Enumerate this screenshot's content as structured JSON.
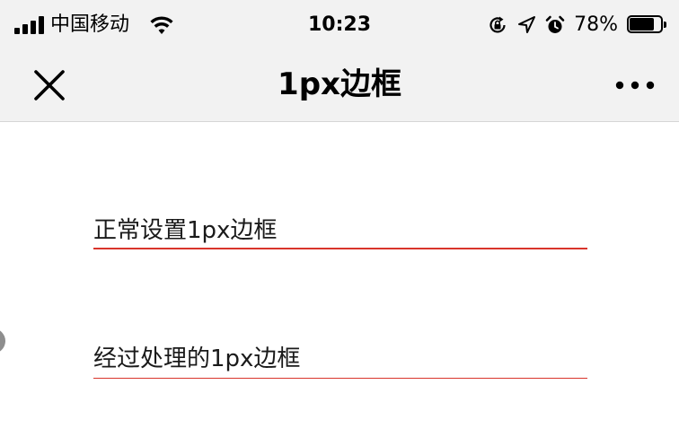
{
  "status_bar": {
    "carrier": "中国移动",
    "time": "10:23",
    "battery_percent_text": "78%",
    "battery_level": 0.78,
    "icons": [
      "signal-icon",
      "wifi-icon",
      "rotation-lock-icon",
      "location-arrow-icon",
      "alarm-icon",
      "battery-icon"
    ]
  },
  "nav": {
    "title": "1px边框",
    "close_icon": "close-icon",
    "more_icon": "more-icon"
  },
  "content": {
    "items": [
      {
        "label": "正常设置1px边框",
        "border_color": "#d9342b"
      },
      {
        "label": "经过处理的1px边框",
        "border_color": "#d9342b"
      }
    ]
  }
}
